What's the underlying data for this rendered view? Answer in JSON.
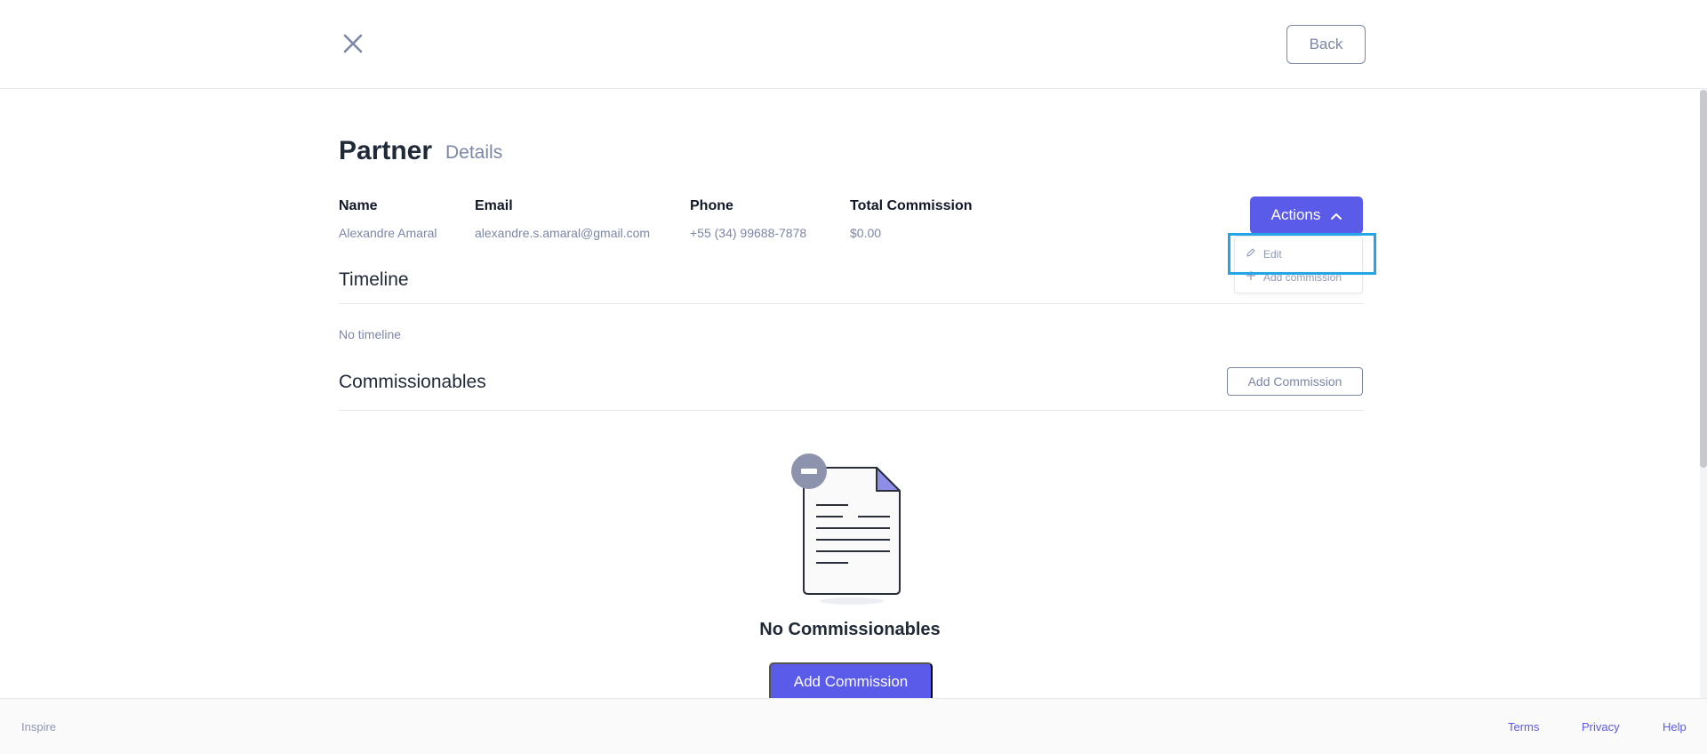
{
  "header": {
    "back_label": "Back"
  },
  "page": {
    "title": "Partner",
    "subtitle": "Details"
  },
  "fields": [
    {
      "label": "Name",
      "value": "Alexandre Amaral"
    },
    {
      "label": "Email",
      "value": "alexandre.s.amaral@gmail.com"
    },
    {
      "label": "Phone",
      "value": "+55 (34) 99688-7878"
    },
    {
      "label": "Total Commission",
      "value": "$0.00"
    }
  ],
  "actions": {
    "label": "Actions",
    "menu": [
      {
        "label": "Edit",
        "icon": "pencil-icon"
      },
      {
        "label": "Add commission",
        "icon": "plus-icon"
      }
    ]
  },
  "timeline": {
    "title": "Timeline",
    "empty_text": "No timeline"
  },
  "commissionables": {
    "title": "Commissionables",
    "add_button": "Add Commission",
    "empty_title": "No Commissionables",
    "empty_button": "Add Commission"
  },
  "footer": {
    "brand": "Inspire",
    "links": [
      "Terms",
      "Privacy",
      "Help"
    ]
  },
  "colors": {
    "accent": "#5b5bea",
    "muted": "#7c86a6",
    "highlight": "#22a6e8"
  }
}
